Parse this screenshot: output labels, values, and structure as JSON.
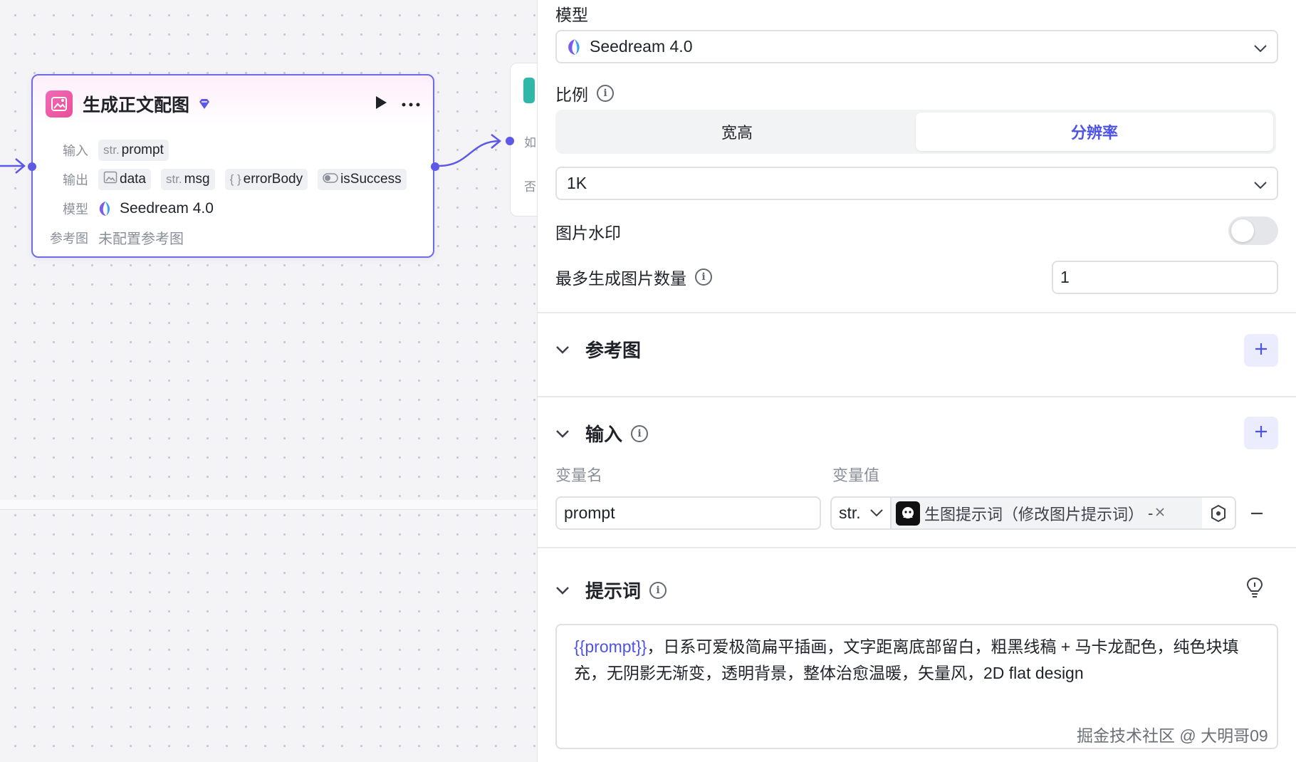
{
  "node": {
    "title": "生成正文配图",
    "input_label": "输入",
    "output_label": "输出",
    "model_label": "模型",
    "ref_label": "参考图",
    "inputs": [
      {
        "type": "str.",
        "name": "prompt"
      }
    ],
    "outputs": [
      {
        "type": "image",
        "name": "data"
      },
      {
        "type": "str.",
        "name": "msg"
      },
      {
        "type": "{ }",
        "name": "errorBody"
      },
      {
        "type": "bool",
        "name": "isSuccess"
      }
    ],
    "model": "Seedream 4.0",
    "ref_value": "未配置参考图"
  },
  "node2": {
    "text1": "如",
    "text2": "否"
  },
  "panel": {
    "model_label": "模型",
    "model_value": "Seedream 4.0",
    "ratio_label": "比例",
    "ratio_tabs": [
      "宽高",
      "分辨率"
    ],
    "ratio_active": 1,
    "resolution_value": "1K",
    "watermark_label": "图片水印",
    "watermark_on": false,
    "max_count_label": "最多生成图片数量",
    "max_count_value": "1",
    "ref_section": "参考图",
    "input_section": "输入",
    "var_name_col": "变量名",
    "var_value_col": "变量值",
    "var_name_value": "prompt",
    "var_type": "str.",
    "var_ref": "生图提示词（修改图片提示词）",
    "var_ref_suffix": "- ",
    "prompt_section": "提示词",
    "prompt_var": "{{prompt}}",
    "prompt_text": "，日系可爱极简扁平插画，文字距离底部留白，粗黑线稿 + 马卡龙配色，纯色块填充，无阴影无渐变，透明背景，整体治愈温暖，矢量风，2D flat design"
  },
  "watermark": "掘金技术社区 @ 大明哥09",
  "colors": {
    "accent": "#4d53e8",
    "node_border": "#6d6bea",
    "node_icon": "#e94f9a"
  }
}
